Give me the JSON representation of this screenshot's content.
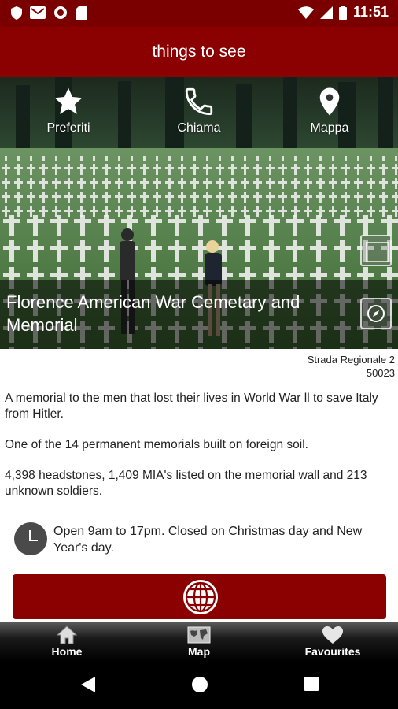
{
  "status_bar": {
    "time": "11:51",
    "left_icons": [
      "shield-icon",
      "gmail-icon",
      "record-icon",
      "sd-card-icon"
    ],
    "right_icons": [
      "wifi-icon",
      "signal-icon",
      "battery-icon"
    ]
  },
  "app_bar": {
    "title": "things to see"
  },
  "hero": {
    "actions": [
      {
        "label": "Preferiti",
        "icon": "star-icon"
      },
      {
        "label": "Chiama",
        "icon": "phone-icon"
      },
      {
        "label": "Mappa",
        "icon": "map-pin-icon"
      }
    ],
    "title": "Florence American War Cemetary and Memorial"
  },
  "address": {
    "line1": "Strada Regionale 2",
    "line2": "50023"
  },
  "description": [
    "A memorial to the men that lost their lives in World War ll to save Italy from Hitler.",
    "One of the 14 permanent memorials built on foreign soil.",
    "4,398 headstones, 1,409 MIA's listed on the memorial wall and 213 unknown soldiers."
  ],
  "hours": {
    "text": "Open 9am to 17pm. Closed on Christmas day and New Year's day."
  },
  "website_button": {
    "icon": "globe-icon"
  },
  "bottom_nav": [
    {
      "label": "Home",
      "icon": "home-icon"
    },
    {
      "label": "Map",
      "icon": "world-map-icon"
    },
    {
      "label": "Favourites",
      "icon": "heart-icon"
    }
  ],
  "colors": {
    "primary": "#8b0000",
    "status_bar": "#7a0000"
  }
}
